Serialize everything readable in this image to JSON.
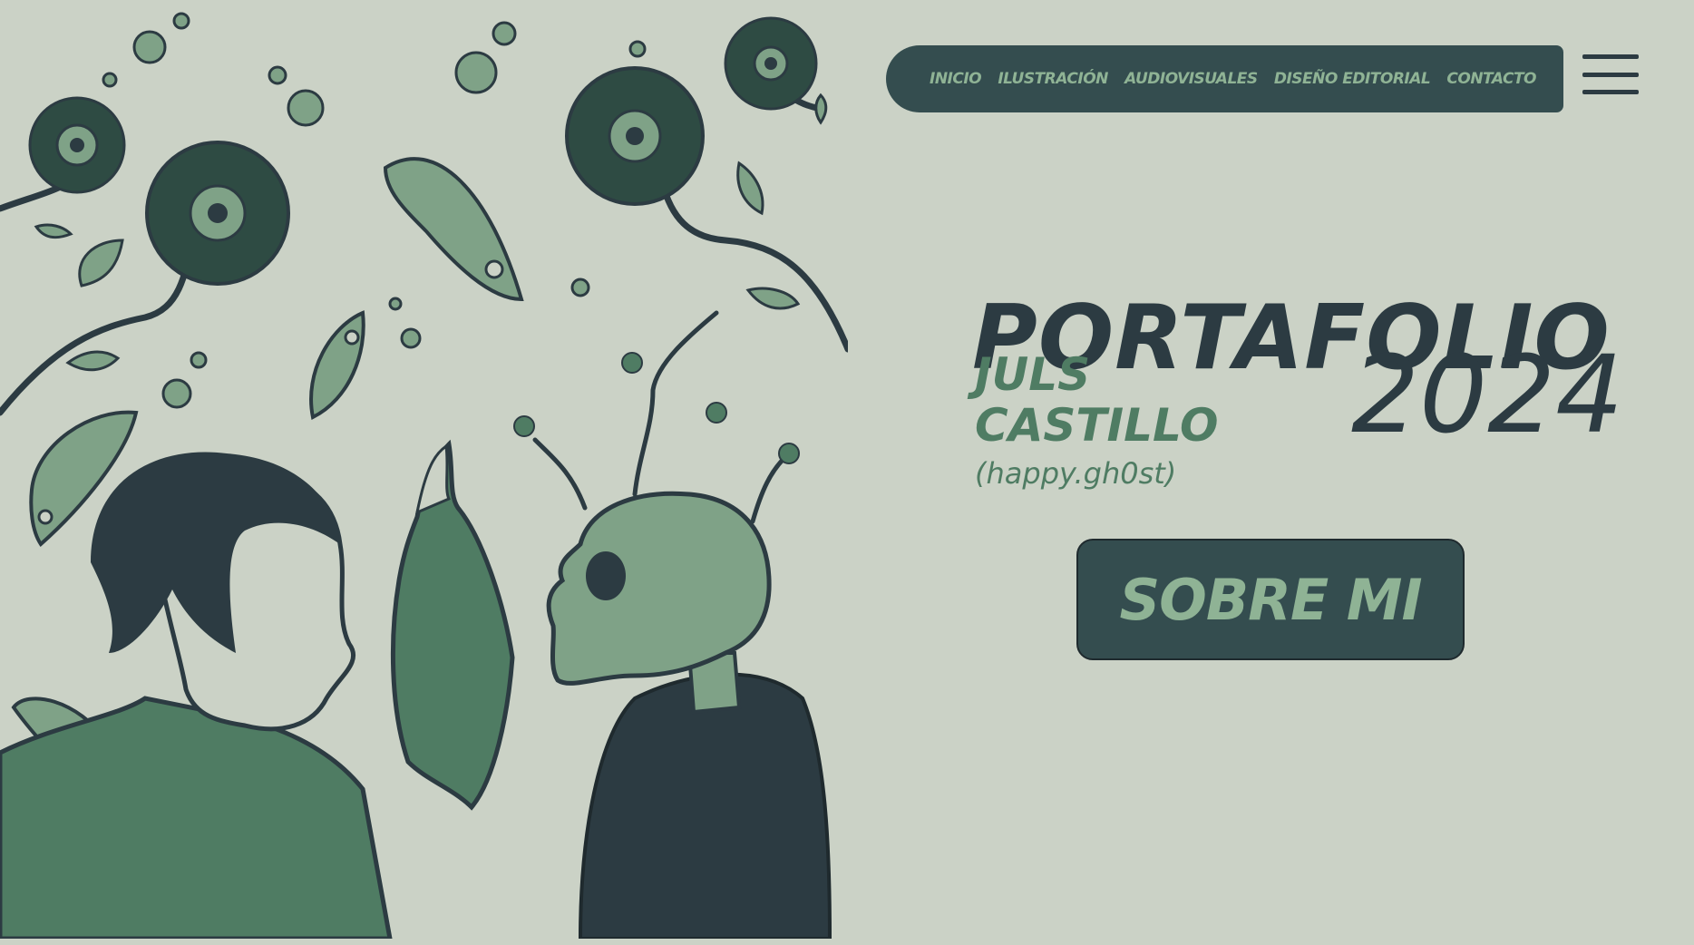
{
  "nav": {
    "items": [
      {
        "label": "INICIO"
      },
      {
        "label": "ILUSTRACIÓN"
      },
      {
        "label": "AUDIOVISUALES"
      },
      {
        "label": "DISEÑO EDITORIAL"
      },
      {
        "label": "CONTACTO"
      }
    ]
  },
  "menu": {
    "icon": "hamburger-menu-icon"
  },
  "hero": {
    "title": "PORTAFOLIO",
    "year": "2024",
    "author_first": "JULS",
    "author_last": "CASTILLO",
    "handle": "(happy.gh0st)",
    "button_label": "SOBRE MI"
  },
  "colors": {
    "background": "#cbd2c6",
    "dark": "#2c3b42",
    "panel": "#344d4f",
    "accent_green": "#8fb395",
    "mid_green": "#4f7c63"
  }
}
